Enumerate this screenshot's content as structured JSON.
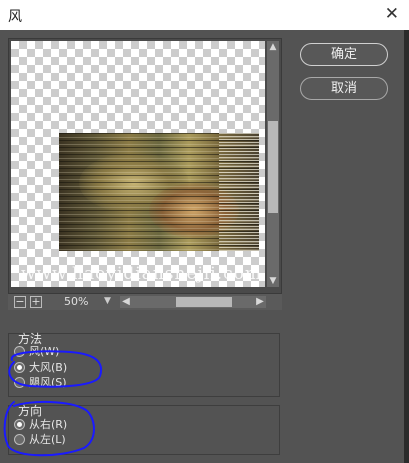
{
  "window": {
    "title": "风",
    "close_glyph": "✕"
  },
  "buttons": {
    "ok_label": "确定",
    "cancel_label": "取消"
  },
  "preview": {
    "watermark_text": "www.haoyidianshejii.com",
    "zoom_level": "50%",
    "zoom_out_glyph": "−",
    "zoom_in_glyph": "+"
  },
  "method": {
    "group_label": "方法",
    "options": [
      {
        "label": "风(W)",
        "selected": false
      },
      {
        "label": "大风(B)",
        "selected": true
      },
      {
        "label": "飓风(S)",
        "selected": false
      }
    ]
  },
  "direction": {
    "group_label": "方向",
    "options": [
      {
        "label": "从右(R)",
        "selected": true
      },
      {
        "label": "从左(L)",
        "selected": false
      }
    ]
  },
  "colors": {
    "dialog_bg": "#535353",
    "annotation_ink": "#1a1aff",
    "titlebar_bg": "#ffffff"
  },
  "icons": {
    "close": "close-icon",
    "scroll_up": "chevron-up-icon",
    "scroll_down": "chevron-down-icon",
    "scroll_left": "chevron-left-icon",
    "scroll_right": "chevron-right-icon",
    "zoom_menu": "dropdown-arrow-icon"
  }
}
